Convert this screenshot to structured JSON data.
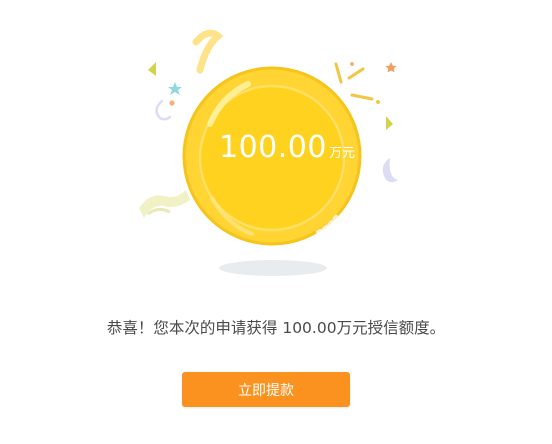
{
  "coin": {
    "amount": "100.00",
    "unit": "万元"
  },
  "message": {
    "text": "恭喜！您本次的申请获得 100.00万元授信额度。"
  },
  "actions": {
    "withdraw_label": "立即提款"
  },
  "colors": {
    "coin_outer": "#ffd433",
    "coin_inner": "#ffd21f",
    "button": "#fb9220",
    "text": "#4a4a4a"
  }
}
